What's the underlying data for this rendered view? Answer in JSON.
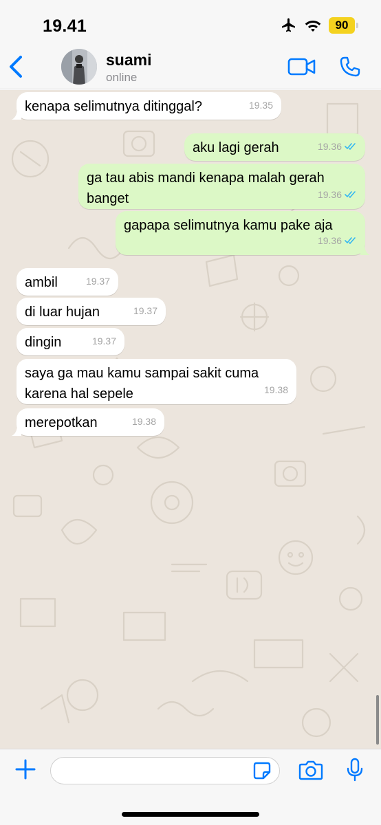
{
  "status_bar": {
    "time": "19.41",
    "battery": "90",
    "icons": [
      "airplane-icon",
      "wifi-icon",
      "battery-icon"
    ]
  },
  "header": {
    "contact_name": "suami",
    "contact_status": "online",
    "icons": [
      "back-chevron-icon",
      "avatar",
      "video-call-icon",
      "phone-call-icon"
    ]
  },
  "messages": [
    {
      "dir": "in",
      "lines": [
        "kenapa selimutnya ditinggal?"
      ],
      "time": "19.35"
    },
    {
      "dir": "out",
      "lines": [
        "aku lagi gerah"
      ],
      "time": "19.36",
      "read": true
    },
    {
      "dir": "out",
      "lines": [
        "ga tau abis mandi kenapa malah gerah",
        "banget"
      ],
      "time": "19.36",
      "read": true
    },
    {
      "dir": "out",
      "lines": [
        "gapapa selimutnya kamu pake aja"
      ],
      "time": "19.36",
      "read": true
    },
    {
      "dir": "in",
      "lines": [
        "ambil"
      ],
      "time": "19.37"
    },
    {
      "dir": "in",
      "lines": [
        "di luar hujan"
      ],
      "time": "19.37"
    },
    {
      "dir": "in",
      "lines": [
        "dingin"
      ],
      "time": "19.37"
    },
    {
      "dir": "in",
      "lines": [
        "saya ga mau kamu sampai sakit cuma",
        "karena hal sepele"
      ],
      "time": "19.38"
    },
    {
      "dir": "in",
      "lines": [
        "merepotkan"
      ],
      "time": "19.38"
    }
  ],
  "composer": {
    "placeholder": "",
    "icons": [
      "plus-icon",
      "sticker-icon",
      "camera-icon",
      "microphone-icon"
    ]
  },
  "colors": {
    "accent": "#007aff",
    "incoming_bubble": "#ffffff",
    "outgoing_bubble": "#dcf8c6",
    "chat_background": "#ece5dd",
    "read_ticks": "#34b7f1",
    "battery": "#f4d21f"
  }
}
